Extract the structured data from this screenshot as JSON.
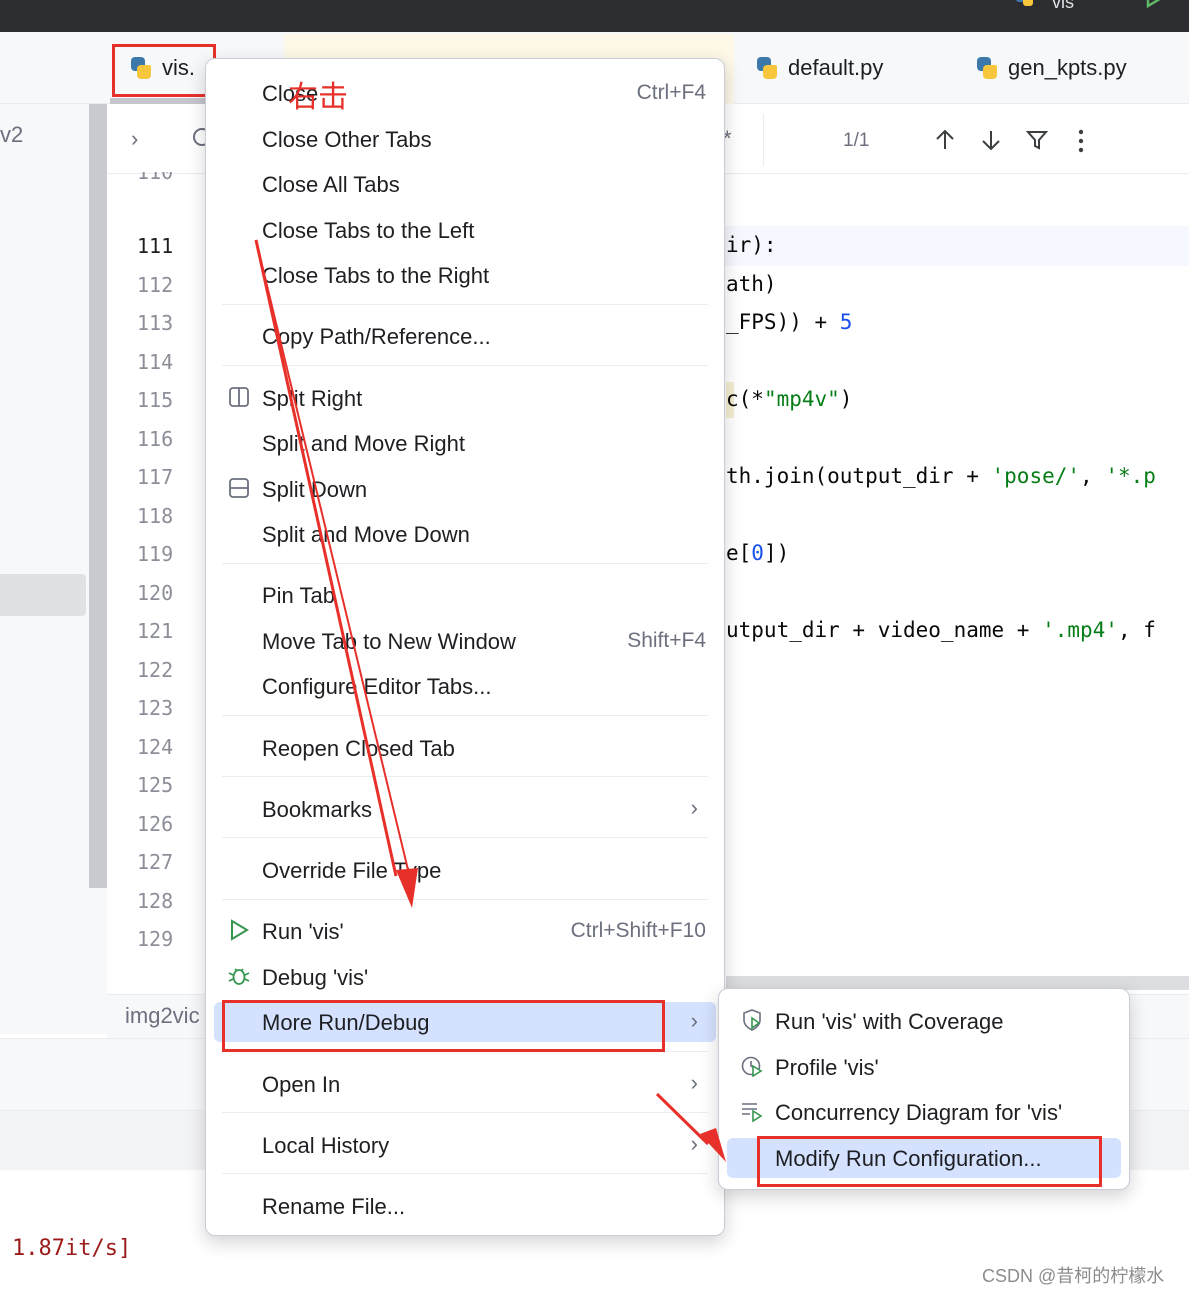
{
  "title_bar": {
    "title": "vis"
  },
  "tabs": [
    {
      "label": "vis."
    },
    {
      "label": "default.py"
    },
    {
      "label": "gen_kpts.py"
    }
  ],
  "sidebar": {
    "partial_label": "v2"
  },
  "breadcrumb": {
    "match_count": "1/1",
    "fragment": "*"
  },
  "gutter": {
    "partial_top": "110",
    "current": "111",
    "lines": [
      "111",
      "112",
      "113",
      "114",
      "115",
      "116",
      "117",
      "118",
      "119",
      "120",
      "121",
      "122",
      "123",
      "124",
      "125",
      "126",
      "127",
      "128",
      "129"
    ]
  },
  "code": {
    "l111": "ir):",
    "l112": "ath)",
    "l113_a": "_FPS)) + ",
    "l113_b": "5",
    "l115_a": "c(*",
    "l115_b": "\"mp4v\"",
    "l115_c": ")",
    "l117_a": "th.join(output_dir + ",
    "l117_b": "'pose/'",
    "l117_c": ", ",
    "l117_d": "'*.p",
    "l119_a": "e[",
    "l119_b": "0",
    "l119_c": "])",
    "l121_a": "utput_dir + video_name + ",
    "l121_b": "'.mp4'",
    "l121_c": ", f"
  },
  "bottom_tab": {
    "label": "img2vic"
  },
  "console": {
    "text": "1.87it/s]"
  },
  "annotation": {
    "text": "右击"
  },
  "watermark": {
    "text": "CSDN @昔柯的柠檬水"
  },
  "context_menu": {
    "close": "Close",
    "close_shortcut": "Ctrl+F4",
    "close_other": "Close Other Tabs",
    "close_all": "Close All Tabs",
    "close_left": "Close Tabs to the Left",
    "close_right": "Close Tabs to the Right",
    "copy_path": "Copy Path/Reference...",
    "split_right": "Split Right",
    "split_move_right": "Split and Move Right",
    "split_down": "Split Down",
    "split_move_down": "Split and Move Down",
    "pin_tab": "Pin Tab",
    "move_tab": "Move Tab to New Window",
    "move_tab_shortcut": "Shift+F4",
    "configure_tabs": "Configure Editor Tabs...",
    "reopen": "Reopen Closed Tab",
    "bookmarks": "Bookmarks",
    "override": "Override File Type",
    "run": "Run 'vis'",
    "run_shortcut": "Ctrl+Shift+F10",
    "debug": "Debug 'vis'",
    "more_run": "More Run/Debug",
    "open_in": "Open In",
    "local_history": "Local History",
    "rename": "Rename File..."
  },
  "submenu": {
    "coverage": "Run 'vis' with Coverage",
    "profile": "Profile 'vis'",
    "concurrency": "Concurrency Diagram for 'vis'",
    "modify": "Modify Run Configuration..."
  },
  "colors": {
    "highlight": "#d4e2ff",
    "annotation_red": "#e8302a",
    "run_green": "#369650",
    "string_green": "#067d17",
    "number_blue": "#1750eb"
  }
}
